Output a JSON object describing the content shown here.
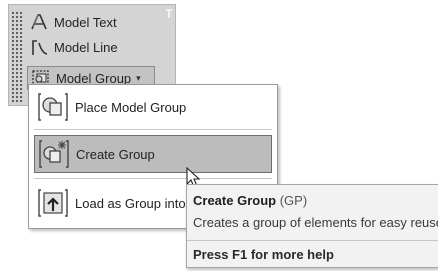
{
  "ribbon": {
    "items": [
      {
        "label": "Model Text",
        "icon": "model-text-icon"
      },
      {
        "label": "Model Line",
        "icon": "model-line-icon"
      },
      {
        "label": "Model Group",
        "icon": "model-group-icon"
      }
    ],
    "dropdown_caret": "▾"
  },
  "menu": {
    "items": [
      {
        "label": "Place Model Group",
        "icon": "place-model-group-icon"
      },
      {
        "label": "Create Group",
        "icon": "create-group-icon",
        "selected": true
      },
      {
        "label": "Load as Group into",
        "icon": "load-as-group-icon"
      }
    ]
  },
  "tooltip": {
    "title": "Create Group",
    "shortcut": "(GP)",
    "description": "Creates a group of elements for easy reuse",
    "help": "Press F1 for more help"
  },
  "colors": {
    "panel_bg": "#d4d4d4",
    "selected_bg": "#bcbcbc",
    "tooltip_bg": "#f2f2f2"
  }
}
